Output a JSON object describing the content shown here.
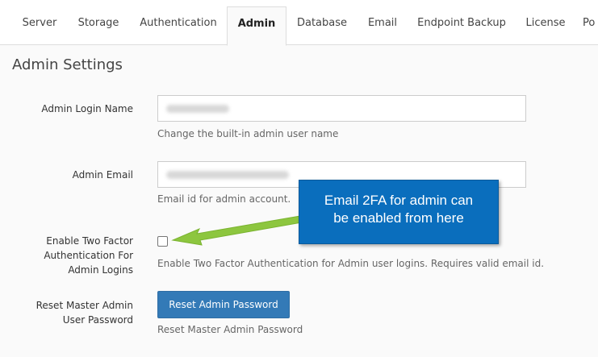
{
  "tabs": [
    {
      "label": "Server",
      "active": false
    },
    {
      "label": "Storage",
      "active": false
    },
    {
      "label": "Authentication",
      "active": false
    },
    {
      "label": "Admin",
      "active": true
    },
    {
      "label": "Database",
      "active": false
    },
    {
      "label": "Email",
      "active": false
    },
    {
      "label": "Endpoint Backup",
      "active": false
    },
    {
      "label": "License",
      "active": false
    },
    {
      "label": "Po",
      "active": false
    }
  ],
  "section_title": "Admin Settings",
  "fields": {
    "admin_login_name": {
      "label": "Admin Login Name",
      "help": "Change the built-in admin user name"
    },
    "admin_email": {
      "label": "Admin Email",
      "help": "Email id for admin account."
    },
    "two_factor": {
      "label_line1": "Enable Two Factor",
      "label_line2": "Authentication For",
      "label_line3": "Admin Logins",
      "checked": false,
      "help": "Enable Two Factor Authentication for Admin user logins. Requires valid email id."
    },
    "reset_password": {
      "label_line1": "Reset Master Admin",
      "label_line2": "User Password",
      "button_label": "Reset Admin Password",
      "help": "Reset Master Admin Password"
    }
  },
  "callout": {
    "line1": "Email 2FA for admin can",
    "line2": "be enabled from here"
  },
  "colors": {
    "primary_button": "#337ab7",
    "callout_bg": "#0a6ebd",
    "arrow": "#8dc63f"
  }
}
